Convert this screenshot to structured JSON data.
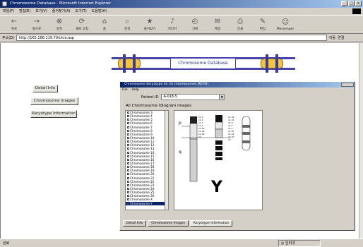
{
  "window": {
    "title": "Chromosome Database - Microsoft Internet Explorer",
    "controls": [
      "_",
      "□",
      "×"
    ]
  },
  "menu": [
    "파일(F)",
    "편집(E)",
    "보기(V)",
    "즐겨찾기(A)",
    "도구(T)",
    "도움말(H)"
  ],
  "toolbar": [
    {
      "label": "뒤로",
      "icon": "back-arrow-icon",
      "glyph": "←"
    },
    {
      "label": "앞으로",
      "icon": "forward-arrow-icon",
      "glyph": "→"
    },
    {
      "label": "중지",
      "icon": "stop-icon",
      "glyph": "⊗"
    },
    {
      "label": "새로 고침",
      "icon": "refresh-icon",
      "glyph": "⟳"
    },
    {
      "label": "홈",
      "icon": "home-icon",
      "glyph": "⌂"
    },
    {
      "label": "검색",
      "icon": "search-icon",
      "glyph": "⌕"
    },
    {
      "label": "즐겨찾기",
      "icon": "favorites-icon",
      "glyph": "★"
    },
    {
      "label": "미디어",
      "icon": "media-icon",
      "glyph": "♪"
    },
    {
      "label": "기록",
      "icon": "history-icon",
      "glyph": "◴"
    },
    {
      "label": "메일",
      "icon": "mail-icon",
      "glyph": "✉"
    },
    {
      "label": "인쇄",
      "icon": "print-icon",
      "glyph": "⎙"
    },
    {
      "label": "편집",
      "icon": "edit-icon",
      "glyph": "✎"
    },
    {
      "label": "Messenger",
      "icon": "messenger-icon",
      "glyph": "☺"
    }
  ],
  "address": {
    "label": "주소(D)",
    "value": "http://165.186.119.79/chro.asp",
    "go_label": "이동",
    "links_label": "연결"
  },
  "banner": {
    "title": "Chromosome Database"
  },
  "nav_buttons": [
    "Detail Info",
    "Chromosome Images",
    "Karyotype Information"
  ],
  "inner_window": {
    "title": "Chromosome Karyotype for 24 chromosomes (KEPD)",
    "menu": [
      "File",
      "Help"
    ],
    "select_label": "Patient ID",
    "select_value": "A-018-5",
    "heading": "All Chromosome Idiogram images",
    "list_items": [
      "Chromosome 3",
      "Chromosome 4",
      "Chromosome 5",
      "Chromosome 6",
      "Chromosome 7",
      "Chromosome 8",
      "Chromosome 9",
      "Chromosome 10",
      "Chromosome 11",
      "Chromosome 12",
      "Chromosome 13",
      "Chromosome 14",
      "Chromosome 15",
      "Chromosome 16",
      "Chromosome 17",
      "Chromosome 18",
      "Chromosome 19",
      "Chromosome 20",
      "Chromosome 21",
      "Chromosome 22",
      "Chromosome 23",
      "Chromosome 24",
      "Chromosome 25",
      "Chromosome 26",
      "Chromosome X",
      "Chromosome Y"
    ],
    "selected_index": 25,
    "idiogram": {
      "label": "Y",
      "arm_p": "p",
      "arm_q": "q",
      "bands_left": [
        "11.3",
        "11.2",
        "11.1",
        "11.1",
        "11.21",
        "11.22",
        "11.23",
        "12"
      ],
      "bands_right": [
        "11.32",
        "11.31",
        "11.2",
        "11.1",
        "11.1",
        "11.21",
        "11.22",
        "11.23",
        "12"
      ]
    },
    "tabs": [
      "Detail Info",
      "Chromosome Images",
      "Karyotype Information"
    ]
  },
  "status": {
    "left": "완료",
    "zone": "인터넷"
  },
  "colors": {
    "titlebar": "#0a246a",
    "banner_rail": "#4444aa",
    "chromosome_body": "#f2c53d"
  }
}
